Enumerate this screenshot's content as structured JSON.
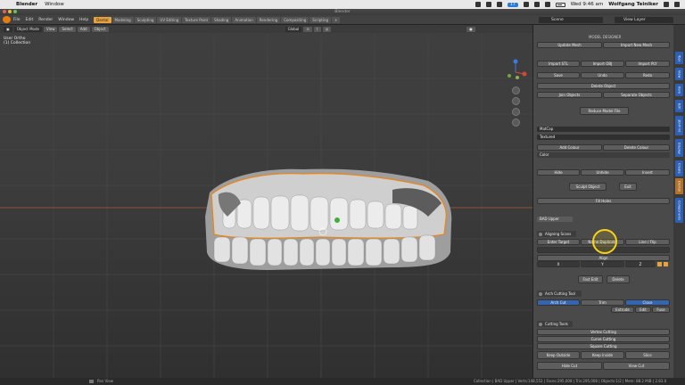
{
  "macbar": {
    "app": "Blender",
    "menu": [
      "Window"
    ],
    "badge": "17",
    "clock": "Wed 9:46 am",
    "user": "Wolfgang Teiniker"
  },
  "window": {
    "title": "Blender"
  },
  "header": {
    "menus": [
      "File",
      "Edit",
      "Render",
      "Window",
      "Help"
    ],
    "workspaces": [
      {
        "label": "Dental",
        "active": true
      },
      {
        "label": "Modeling",
        "active": false
      },
      {
        "label": "Sculpting",
        "active": false
      },
      {
        "label": "UV Editing",
        "active": false
      },
      {
        "label": "Texture Paint",
        "active": false
      },
      {
        "label": "Shading",
        "active": false
      },
      {
        "label": "Animation",
        "active": false
      },
      {
        "label": "Rendering",
        "active": false
      },
      {
        "label": "Compositing",
        "active": false
      },
      {
        "label": "Scripting",
        "active": false
      }
    ],
    "scene": "Scene",
    "view_layer": "View Layer"
  },
  "viewport": {
    "mode": "Object Mode",
    "orientation": "Global",
    "info_line": "User Ortho",
    "collection": "(1) Collection"
  },
  "panel": {
    "title": "MODEL DESIGNER",
    "update_mesh": "Update Mesh",
    "import_nbr": "Import New Mesh",
    "import_stl": "Import STL",
    "import_obj": "Import OBJ",
    "import_ply": "Import PLY",
    "save": "Save",
    "undo": "Undo",
    "redo": "Redo",
    "delete_object": "Delete Object",
    "join_objects": "Join Objects",
    "separate_objects": "Separate Objects",
    "reduce_model": "Reduce Model File",
    "matcap": "MatCap",
    "textured": "Textured",
    "add_colour": "Add Colour",
    "delete_colour": "Delete Colour",
    "color": "Color",
    "hide": "Hide",
    "unhide": "Unhide",
    "invert": "Invert",
    "sculpt_object": "Sculpt Object",
    "exit": "Exit",
    "fill_holes": "Fill Holes",
    "bad_upper": "BAD Upper",
    "aligning_scans": "Aligning Scans",
    "enter_target": "Enter Target",
    "name_duplicate": "Name Duplicate",
    "line_flip": "Line / Flip",
    "align": "Align",
    "coord_x": "X",
    "coord_y": "Y",
    "coord_z": "Z",
    "fast_edit": "Fast Edit",
    "delete": "Delete",
    "arch_cutting_tool": "Arch Cutting Tool",
    "arch_cut": "Arch Cut",
    "trim": "Trim",
    "close": "Close",
    "extrude": "Extrude",
    "edit": "Edit",
    "fuse": "Fuse",
    "cutting_tools": "Cutting Tools",
    "vertex_cutting": "Vertex Cutting",
    "curve_cutting": "Curve Cutting",
    "square_cutting": "Square Cutting",
    "keep_outside": "Keep Outside",
    "keep_inside": "Keep Inside",
    "slice": "Slice",
    "hide_cut": "Hide Cut",
    "view_cut": "View Cut"
  },
  "tabs": [
    "Tool",
    "View",
    "Item",
    "Edit",
    "3D-Print",
    "Display",
    "Create",
    "Dental",
    "Components"
  ],
  "status": {
    "left": "Pan View",
    "right": "Collection | BAD Upper | Verts:148,552 | Faces:295,008 | Tris:295,008 | Objects:1/2 | Mem: 88.2 MiB | 2.83.0"
  }
}
